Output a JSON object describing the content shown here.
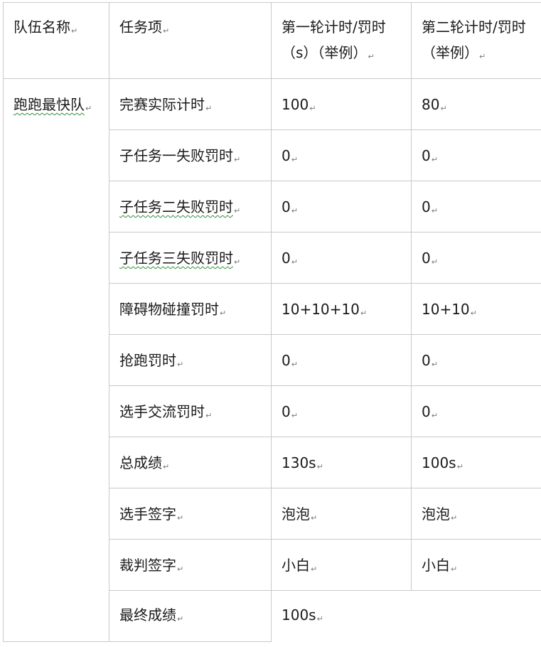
{
  "header": {
    "team_name": "队伍名称",
    "task_item": "任务项",
    "round1": "第一轮计时/罚时（s）（举例）",
    "round2": "第二轮计时/罚时（举例）"
  },
  "team": "跑跑最快队",
  "rows": [
    {
      "task": "完赛实际计时",
      "r1": "100",
      "r2": "80"
    },
    {
      "task": "子任务一失败罚时",
      "r1": "0",
      "r2": "0"
    },
    {
      "task": "子任务二失败罚时",
      "r1": "0",
      "r2": "0"
    },
    {
      "task": "子任务三失败罚时",
      "r1": "0",
      "r2": "0"
    },
    {
      "task": "障碍物碰撞罚时",
      "r1": "10+10+10",
      "r2": "10+10"
    },
    {
      "task": "抢跑罚时",
      "r1": "0",
      "r2": "0"
    },
    {
      "task": "选手交流罚时",
      "r1": "0",
      "r2": "0"
    },
    {
      "task": "总成绩",
      "r1": "130s",
      "r2": "100s"
    },
    {
      "task": "选手签字",
      "r1": "泡泡",
      "r2": "泡泡"
    },
    {
      "task": "裁判签字",
      "r1": "小白",
      "r2": "小白"
    }
  ],
  "final": {
    "label": "最终成绩",
    "value": "100s"
  },
  "paragraph_mark": "↵"
}
